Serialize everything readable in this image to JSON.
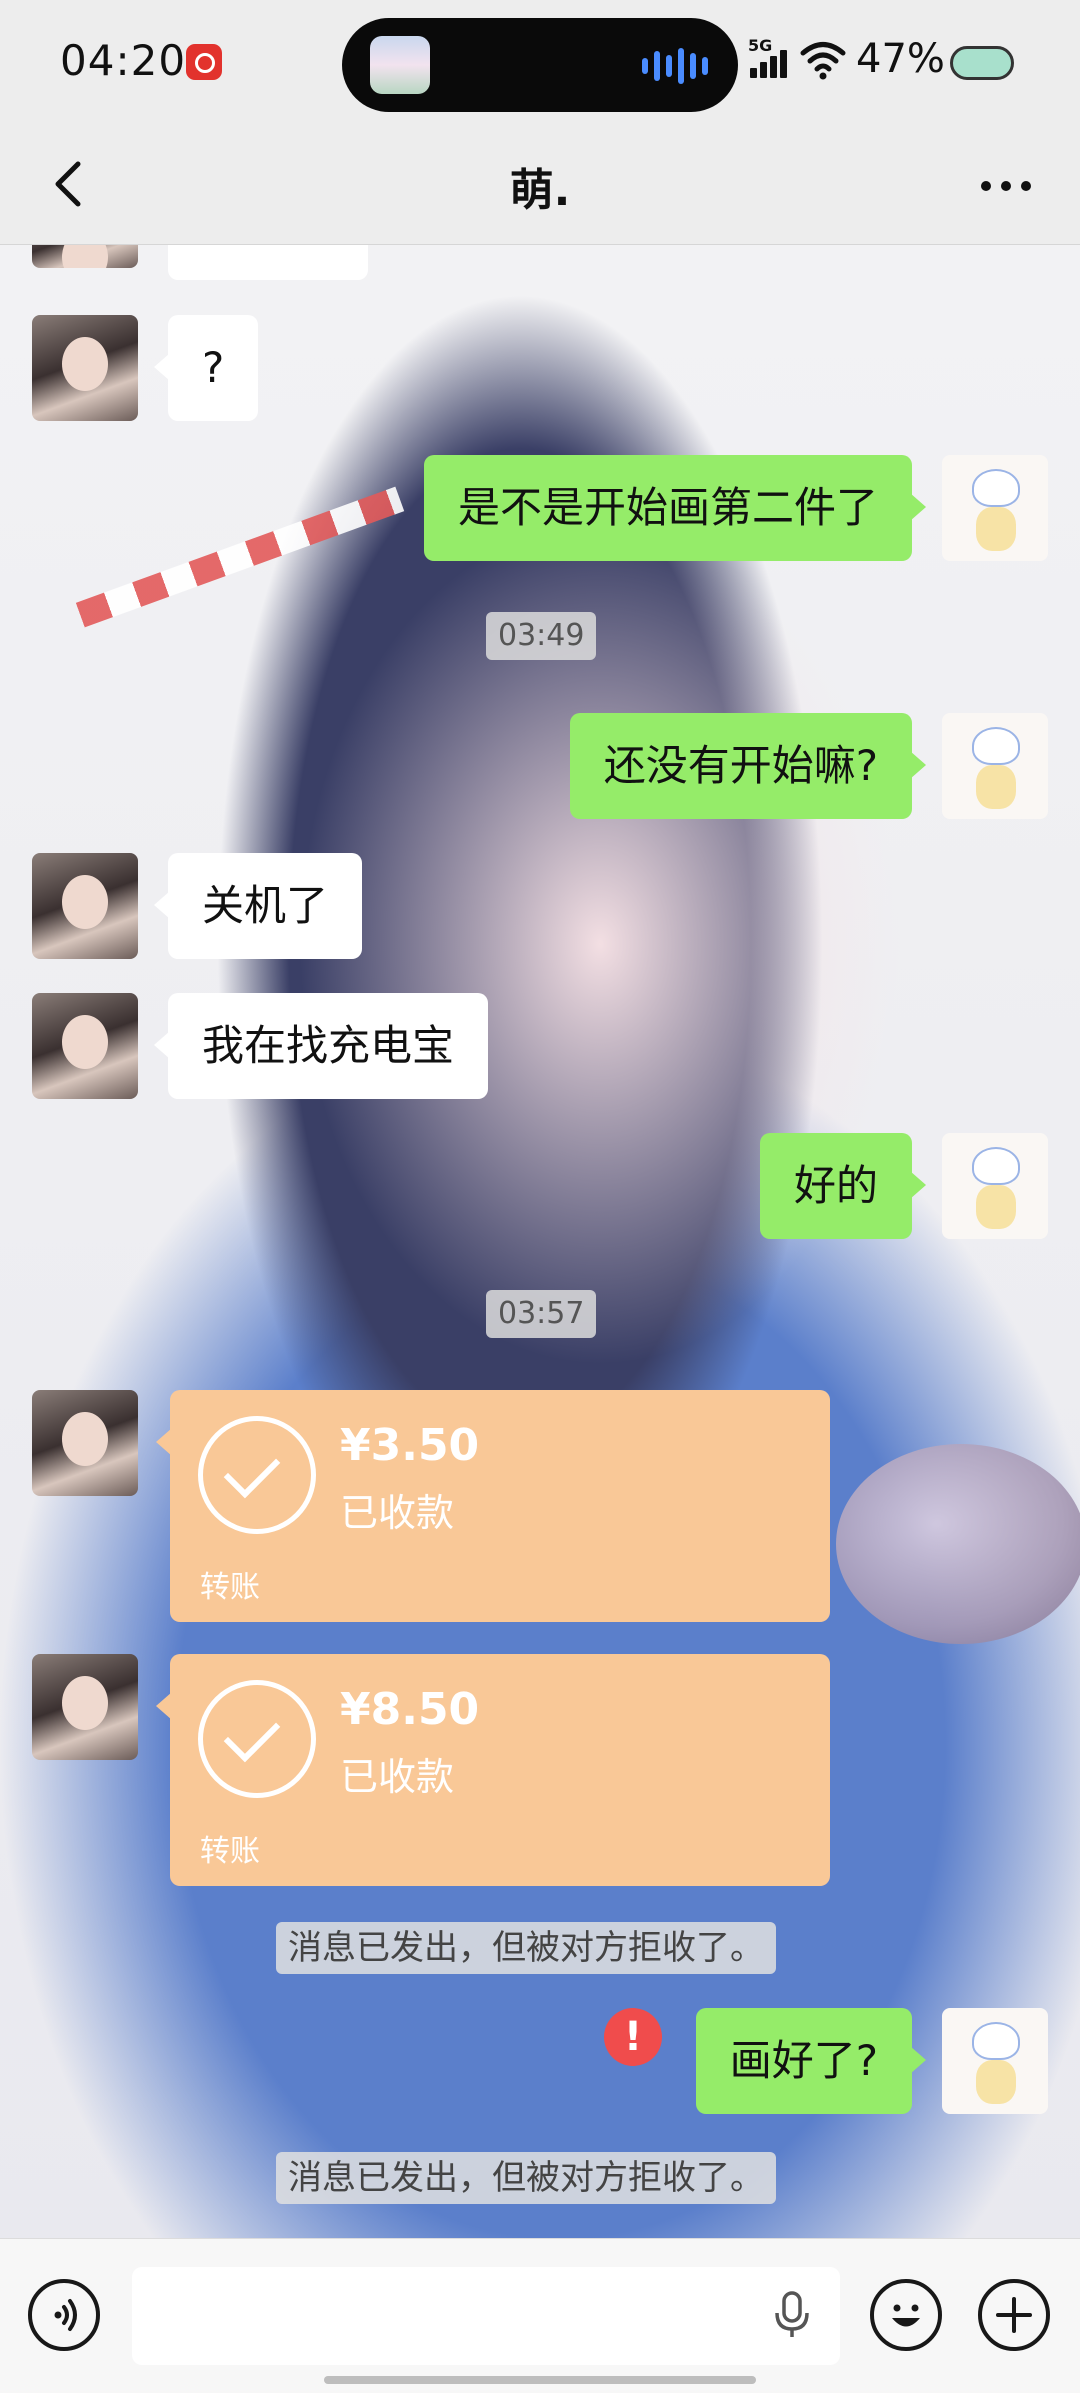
{
  "status_bar": {
    "time": "04:20",
    "network": "5G",
    "battery": "47%"
  },
  "nav": {
    "title": "萌."
  },
  "messages": [
    {
      "side": "in",
      "text": "?"
    },
    {
      "side": "out",
      "text": "是不是开始画第二件了"
    },
    {
      "type": "timestamp",
      "text": "03:49"
    },
    {
      "side": "out",
      "text": "还没有开始嘛?"
    },
    {
      "side": "in",
      "text": "关机了"
    },
    {
      "side": "in",
      "text": "我在找充电宝"
    },
    {
      "side": "out",
      "text": "好的"
    },
    {
      "type": "timestamp",
      "text": "03:57"
    },
    {
      "type": "transfer",
      "amount": "¥3.50",
      "status": "已收款",
      "label": "转账"
    },
    {
      "type": "transfer",
      "amount": "¥8.50",
      "status": "已收款",
      "label": "转账"
    },
    {
      "type": "system",
      "text": "消息已发出，但被对方拒收了。"
    },
    {
      "side": "out",
      "text": "画好了?",
      "failed": true
    },
    {
      "type": "system",
      "text": "消息已发出，但被对方拒收了。"
    }
  ],
  "icons": {
    "back": "chevron-left-icon",
    "more": "more-horizontal-icon",
    "voice": "voice-input-icon",
    "mic": "microphone-icon",
    "emoji": "emoji-icon",
    "plus": "plus-icon",
    "error": "error-icon"
  },
  "colors": {
    "outgoing_bubble": "#95ec69",
    "incoming_bubble": "#ffffff",
    "transfer_card": "#f9c897",
    "error": "#f04c4c"
  }
}
